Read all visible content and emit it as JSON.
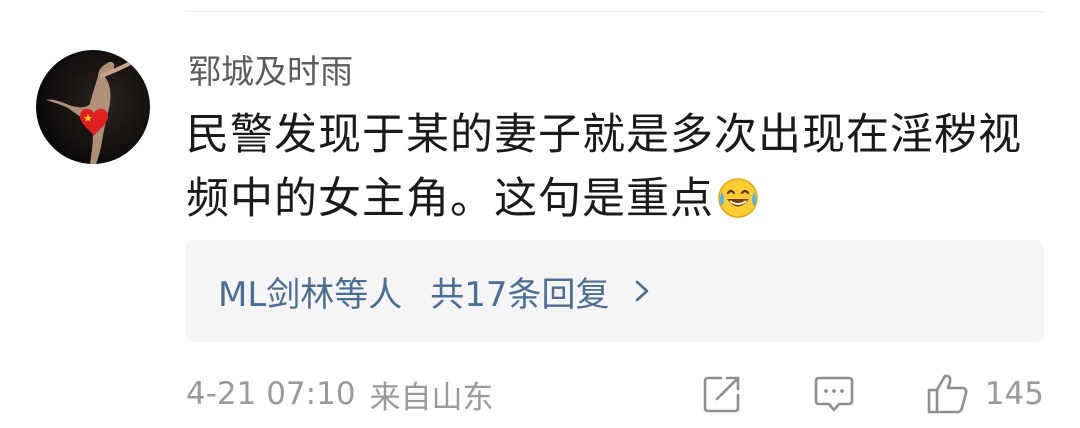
{
  "comment": {
    "username": "郓城及时雨",
    "text_line1": "民警发现于某的妻子就是多次出现在淫秽视",
    "text_line2": "频中的女主角。这句是重点",
    "emoji_icon": "laugh-cry-emoji"
  },
  "replies": {
    "users": "ML剑林",
    "suffix": "等人",
    "count_label": "共17条回复"
  },
  "footer": {
    "timestamp": "4-21 07:10",
    "location": "来自山东",
    "like_count": "145"
  },
  "colors": {
    "link": "#4b6e96",
    "meta": "#9a9a9a",
    "username": "#5c5c5c",
    "reply_bg": "#f5f5f5",
    "heart": "#e02020"
  }
}
